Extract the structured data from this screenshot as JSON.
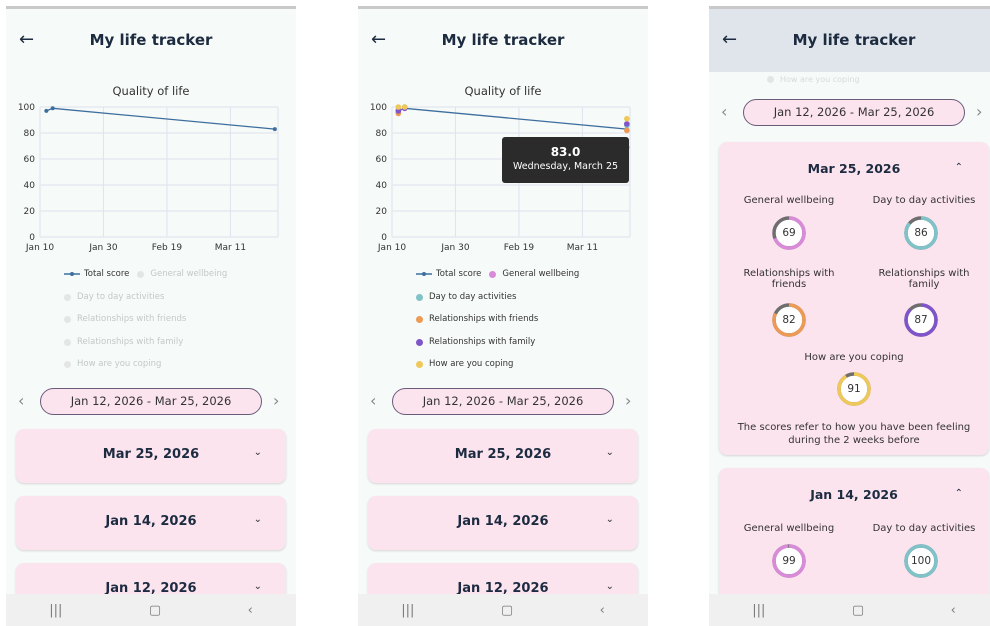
{
  "app": {
    "title": "My life tracker",
    "back_icon": "arrow-left-icon"
  },
  "chart": {
    "title": "Quality of life",
    "y_ticks": [
      "0",
      "20",
      "40",
      "60",
      "80",
      "100"
    ],
    "x_ticks": [
      "Jan 10",
      "Jan 30",
      "Feb 19",
      "Mar 11"
    ]
  },
  "legend": {
    "total_score": "Total score",
    "general_wellbeing": "General wellbeing",
    "day_to_day": "Day to day activities",
    "friends": "Relationships with friends",
    "family": "Relationships with family",
    "coping": "How are you coping"
  },
  "colors": {
    "total": "#3d6e9e",
    "wellbeing": "#d98ad8",
    "day_to_day": "#7fc2c8",
    "friends": "#ec9a55",
    "family": "#7f55c9",
    "coping": "#efc85a",
    "card_bg": "#fce4ef"
  },
  "chart_data": {
    "type": "line",
    "title": "Quality of life",
    "xlabel": "",
    "ylabel": "",
    "ylim": [
      0,
      100
    ],
    "x_ticks": [
      "Jan 10",
      "Jan 30",
      "Feb 19",
      "Mar 11"
    ],
    "series": [
      {
        "name": "Total score",
        "x": [
          "Jan 12",
          "Jan 14",
          "Mar 25"
        ],
        "values": [
          97,
          99,
          83
        ]
      },
      {
        "name": "General wellbeing",
        "x": [
          "Jan 12",
          "Jan 14",
          "Mar 25"
        ],
        "values": [
          96,
          99,
          69
        ]
      },
      {
        "name": "Day to day activities",
        "x": [
          "Jan 12",
          "Jan 14",
          "Mar 25"
        ],
        "values": [
          98,
          100,
          86
        ]
      },
      {
        "name": "Relationships with friends",
        "x": [
          "Jan 12",
          "Jan 14",
          "Mar 25"
        ],
        "values": [
          95,
          99,
          82
        ]
      },
      {
        "name": "Relationships with family",
        "x": [
          "Jan 12",
          "Jan 14",
          "Mar 25"
        ],
        "values": [
          97,
          99,
          87
        ]
      },
      {
        "name": "How are you coping",
        "x": [
          "Jan 12",
          "Jan 14",
          "Mar 25"
        ],
        "values": [
          100,
          100,
          91
        ]
      }
    ]
  },
  "tooltip": {
    "value": "83.0",
    "date": "Wednesday, March 25"
  },
  "range": {
    "label": "Jan 12, 2026 - Mar 25, 2026",
    "prev_icon": "chevron-left-icon",
    "next_icon": "chevron-right-icon"
  },
  "entries": [
    {
      "date": "Mar 25, 2026"
    },
    {
      "date": "Jan 14, 2026"
    },
    {
      "date": "Jan 12, 2026"
    }
  ],
  "detail": {
    "mar25": {
      "date": "Mar 25, 2026",
      "general_wellbeing": "69",
      "day_to_day": "86",
      "friends": "82",
      "family": "87",
      "coping": "91"
    },
    "jan14": {
      "date": "Jan 14, 2026",
      "general_wellbeing": "99",
      "day_to_day": "100"
    },
    "labels": {
      "general_wellbeing": "General wellbeing",
      "day_to_day": "Day to day activities",
      "friends_1": "Relationships with",
      "friends_2": "friends",
      "family_1": "Relationships with",
      "family_2": "family",
      "coping": "How are you coping"
    },
    "note_1": "The scores refer to how you have been feeling",
    "note_2": "during the 2 weeks before"
  },
  "navbar": {
    "recent": "|||",
    "home": "▢",
    "back": "‹"
  }
}
